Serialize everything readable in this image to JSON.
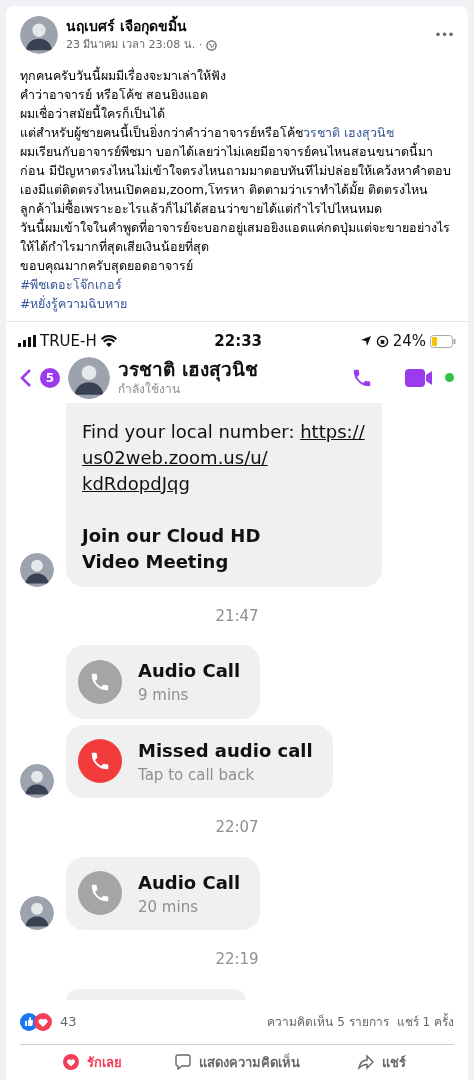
{
  "post": {
    "author": "นฤเบศร์ เจือกุดขมิ้น",
    "time": "23 มีนาคม เวลา 23:08 น. ·",
    "more": "•••",
    "lines": [
      {
        "text": "ทุกคนครับวันนี้ผมมีเรื่องจะมาเล่าให้ฟัง"
      },
      {
        "text": "คำว่าอาจารย์ หรือโค้ช สอนยิงแอด"
      },
      {
        "text": "ผมเชื่อว่าสมัยนี้ใครก็เป็นได้"
      },
      {
        "text": "แต่สำหรับผู้ชายคนนี้เป็นยิ่งกว่าคำว่าอาจารย์หรือโค้ช",
        "mention": "วรชาติ เฮงสุวนิช"
      },
      {
        "text": "ผมเรียนกับอาจารย์พีชมา บอกได้เลยว่าไม่เคยมีอาจารย์คนไหนสอนขนาดนี้มาก่อน มีปัญหาตรงไหนไม่เข้าใจตรงไหนถามมาตอบทันทีไม่ปล่อยให้เคว้งหาคำตอบเองมีแต่ติดตรงไหนเปิดคอม,zoom,โทรหา ติดตามว่าเราทำได้มั้ย ติดตรงไหน ลูกค้าไม่ซื้อเพราะอะไรแล้วก็ไม่ได้สอนว่าขายได้แต่กำไรไปไหนหมด"
      },
      {
        "text": "วันนี้ผมเข้าใจในคำพูดที่อาจารย์จะบอกอยู่เสมอยิงแอดแค่กดปุ่มแต่จะขายอย่างไรให้ได้กำไรมากที่สุดเสียเงินน้อยที่สุด"
      },
      {
        "text": "ขอบคุณมากครับสุดยอดอาจารย์"
      }
    ],
    "hashtags": [
      "#พีชเดอะโจ๊กเกอร์",
      "#หยั่งรู้ความฉิบหาย"
    ]
  },
  "phone": {
    "carrier": "TRUE-H",
    "clock": "22:33",
    "battery": "24%",
    "back_badge": "5",
    "contact": "วรชาติ เฮงสุวนิช",
    "status": "กำลังใช้งาน",
    "messages": [
      {
        "kind": "text",
        "lines": [
          "Find your local number: "
        ],
        "link": [
          "https://",
          "us02web.zoom.us/u/",
          "kdRdopdJqg"
        ],
        "bold": [
          "Join our Cloud HD",
          "Video Meeting"
        ],
        "avatar": true
      },
      {
        "kind": "time",
        "text": "21:47"
      },
      {
        "kind": "call",
        "missed": false,
        "title": "Audio Call",
        "sub": "9 mins",
        "avatar": false
      },
      {
        "kind": "call",
        "missed": true,
        "title": "Missed audio call",
        "sub": "Tap to call back",
        "avatar": true
      },
      {
        "kind": "time",
        "text": "22:07"
      },
      {
        "kind": "call",
        "missed": false,
        "title": "Audio Call",
        "sub": "20 mins",
        "avatar": true
      },
      {
        "kind": "time",
        "text": "22:19"
      },
      {
        "kind": "partial"
      }
    ]
  },
  "stats": {
    "reactions": "43",
    "comments": "ความคิดเห็น 5 รายการ",
    "shares": "แชร์ 1 ครั้ง"
  },
  "actions": [
    {
      "kind": "love",
      "label": "รักเลย",
      "selected": true
    },
    {
      "kind": "comment",
      "label": "แสดงความคิดเห็น",
      "selected": false
    },
    {
      "kind": "share",
      "label": "แชร์",
      "selected": false
    }
  ]
}
